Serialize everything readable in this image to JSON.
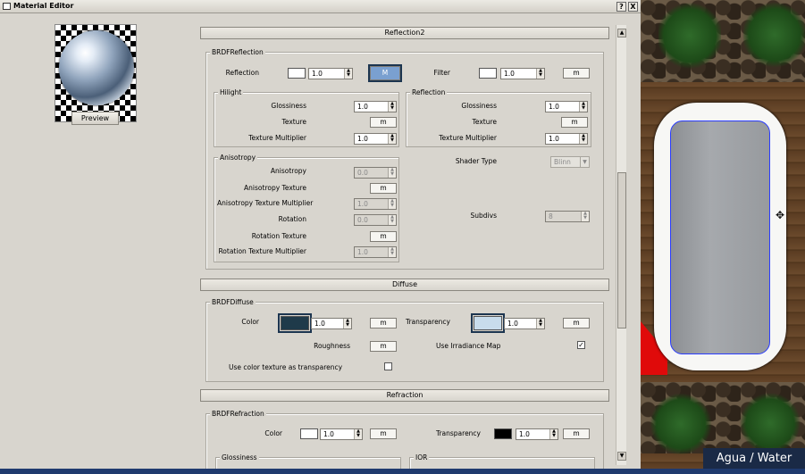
{
  "window": {
    "title": "Material Editor",
    "help_btn": "?",
    "close_btn": "X"
  },
  "preview": {
    "button": "Preview"
  },
  "sections": {
    "reflection2": "Reflection2",
    "diffuse": "Diffuse",
    "refraction": "Refraction"
  },
  "brdf_reflection": {
    "group": "BRDFReflection",
    "reflection_label": "Reflection",
    "reflection_value": "1.0",
    "reflection_map": "M",
    "filter_label": "Filter",
    "filter_value": "1.0",
    "filter_map": "m",
    "hilight": {
      "group": "Hilight",
      "glossiness_label": "Glossiness",
      "glossiness_value": "1.0",
      "texture_label": "Texture",
      "texture_map": "m",
      "texmult_label": "Texture Multiplier",
      "texmult_value": "1.0"
    },
    "reflection": {
      "group": "Reflection",
      "glossiness_label": "Glossiness",
      "glossiness_value": "1.0",
      "texture_label": "Texture",
      "texture_map": "m",
      "texmult_label": "Texture Multiplier",
      "texmult_value": "1.0"
    },
    "anisotropy": {
      "group": "Anisotropy",
      "anisotropy_label": "Anisotropy",
      "anisotropy_value": "0.0",
      "aniso_tex_label": "Anisotropy Texture",
      "aniso_tex_map": "m",
      "aniso_mult_label": "Anisotropy Texture Multiplier",
      "aniso_mult_value": "1.0",
      "rotation_label": "Rotation",
      "rotation_value": "0.0",
      "rot_tex_label": "Rotation Texture",
      "rot_tex_map": "m",
      "rot_mult_label": "Rotation Texture Multiplier",
      "rot_mult_value": "1.0"
    },
    "shader_type_label": "Shader Type",
    "shader_type_value": "Blinn",
    "subdivs_label": "Subdivs",
    "subdivs_value": "8"
  },
  "brdf_diffuse": {
    "group": "BRDFDiffuse",
    "color_label": "Color",
    "color_value": "1.0",
    "color_map": "m",
    "transparency_label": "Transparency",
    "transparency_value": "1.0",
    "transparency_map": "m",
    "roughness_label": "Roughness",
    "roughness_map": "m",
    "irradiance_label": "Use Irradiance Map",
    "irradiance_checked": "✓",
    "color_tex_label": "Use color texture as transparency",
    "color_tex_checked": ""
  },
  "brdf_refraction": {
    "group": "BRDFRefraction",
    "color_label": "Color",
    "color_value": "1.0",
    "color_map": "m",
    "transparency_label": "Transparency",
    "transparency_value": "1.0",
    "transparency_map": "m",
    "glossiness_group": "Glossiness",
    "ior_group": "IOR"
  },
  "viewport": {
    "caption": "Agua / Water"
  },
  "colors": {
    "diffuse_color": "#1f3a4a",
    "diffuse_transparency": "#c8dcec",
    "refraction_transparency": "#000000"
  }
}
